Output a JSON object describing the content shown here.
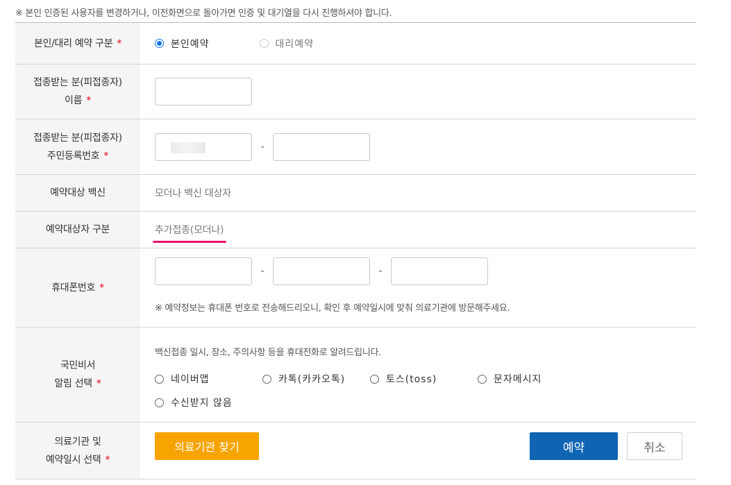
{
  "notice": "※ 본인 인증된 사용자를 변경하거나, 이전화면으로 돌아가면 인증 및 대기열을 다시 진행하셔야 합니다.",
  "required_mark": "*",
  "rows": {
    "reservation_type": {
      "label": "본인/대리 예약 구분",
      "options": [
        {
          "label": "본인예약",
          "selected": true
        },
        {
          "label": "대리예약",
          "selected": false,
          "disabled": true
        }
      ]
    },
    "name": {
      "label_line1": "접종받는 분(피접종자)",
      "label_line2": "이름",
      "value": ""
    },
    "rrn": {
      "label_line1": "접종받는 분(피접종자)",
      "label_line2": "주민등록번호",
      "separator": "-",
      "back_value": ""
    },
    "vaccine": {
      "label": "예약대상 백신",
      "value": "모더나 백신 대상자"
    },
    "target_type": {
      "label": "예약대상자 구분",
      "value": "추가접종(모더나)"
    },
    "phone": {
      "label": "휴대폰번호",
      "separator": "-",
      "note": "※ 예약정보는 휴대폰 번호로 전송해드리오니, 확인 후 예약일시에 맞춰 의료기관에 방문해주세요."
    },
    "notification": {
      "label_line1": "국민비서",
      "label_line2": "알림 선택",
      "description": "백신접종 일시, 장소, 주의사항 등을 휴대전화로 알려드립니다.",
      "options": [
        "네이버앱",
        "카톡(카카오톡)",
        "토스(toss)",
        "문자메시지",
        "수신받지 않음"
      ]
    },
    "facility": {
      "label_line1": "의료기관 및",
      "label_line2": "예약일시 선택",
      "find_button": "의료기관 찾기",
      "reserve_button": "예약",
      "cancel_button": "취소"
    }
  },
  "colors": {
    "accent_blue": "#0f65b4",
    "orange": "#f7a400",
    "required_red": "#e60012",
    "highlight_pink": "#e5146c"
  }
}
